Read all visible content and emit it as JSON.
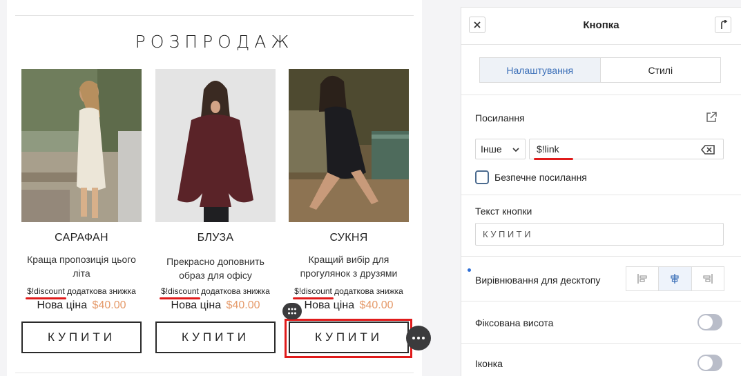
{
  "canvas": {
    "section_title": "РОЗПРОДАЖ",
    "products": [
      {
        "name": "САРАФАН",
        "desc_line1": "Краща пропозиція цього",
        "desc_line2": "літа",
        "discount_tag": "$!discount",
        "discount_text": " додаткова знижка",
        "price_label": "Нова ціна",
        "price_value": "$40.00",
        "button_label": "КУПИТИ"
      },
      {
        "name": "БЛУЗА",
        "desc_line1": "Прекрасно доповнить",
        "desc_line2": "образ для офісу",
        "discount_tag": "$!discount",
        "discount_text": " додаткова знижка",
        "price_label": "Нова ціна",
        "price_value": "$40.00",
        "button_label": "КУПИТИ"
      },
      {
        "name": "СУКНЯ",
        "desc_line1": "Кращий вибір для",
        "desc_line2": "прогулянок з друзями",
        "discount_tag": "$!discount",
        "discount_text": " додаткова знижка",
        "price_label": "Нова ціна",
        "price_value": "$40.00",
        "button_label": "КУПИТИ"
      }
    ],
    "colors": {
      "price_accent": "#e59a6a",
      "highlight_red": "#e01b1b"
    }
  },
  "panel": {
    "title": "Кнопка",
    "tabs": [
      {
        "label": "Налаштування",
        "active": true
      },
      {
        "label": "Стилі",
        "active": false
      }
    ],
    "link_label": "Посилання",
    "link_type": "Інше",
    "link_value": "$!link",
    "secure_link_label": "Безпечне посилання",
    "button_text_label": "Текст кнопки",
    "button_text_value": "КУПИТИ",
    "alignment_label": "Вирівнювання для десктопу",
    "alignment_selected": "center",
    "fixed_height_label": "Фіксована висота",
    "fixed_height_on": false,
    "icon_label": "Іконка",
    "icon_on": false,
    "icons": [
      "close-icon",
      "undock-icon",
      "external-link-icon",
      "chevron-down-icon",
      "backspace-icon",
      "align-left-icon",
      "align-center-icon",
      "align-right-icon",
      "drag-grip-icon",
      "more-icon"
    ]
  }
}
